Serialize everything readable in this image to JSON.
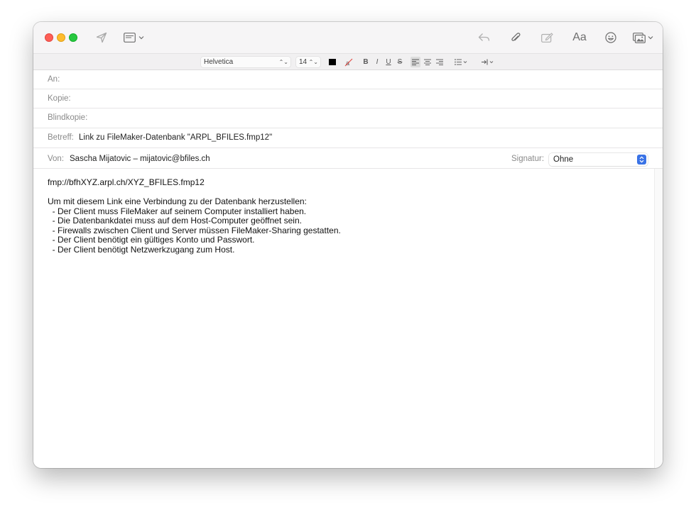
{
  "toolbar": {
    "icons": [
      "send-icon",
      "header-fields-icon",
      "chevron-down-icon",
      "reply-icon",
      "paperclip-icon",
      "markup-icon",
      "format-icon",
      "emoji-icon",
      "photo-browser-icon"
    ],
    "format_label": "Aa"
  },
  "format_bar": {
    "font": "Helvetica",
    "size": "14",
    "text_color": "#000000",
    "bold": "B",
    "italic": "I",
    "underline": "U",
    "strike": "S"
  },
  "header": {
    "to_label": "An:",
    "to_value": "",
    "cc_label": "Kopie:",
    "cc_value": "",
    "bcc_label": "Blindkopie:",
    "bcc_value": "",
    "subject_label": "Betreff:",
    "subject_value": "Link zu FileMaker-Datenbank \"ARPL_BFILES.fmp12\"",
    "from_label": "Von:",
    "from_value": "Sascha Mijatovic – mijatovic@bfiles.ch",
    "signature_label": "Signatur:",
    "signature_value": "Ohne"
  },
  "message": {
    "link": "fmp://bfhXYZ.arpl.ch/XYZ_BFILES.fmp12",
    "intro": "Um mit diesem Link eine Verbindung zu der Datenbank herzustellen:",
    "requirements": [
      "  - Der Client muss FileMaker auf seinem Computer installiert haben.",
      "  - Die Datenbankdatei muss auf dem Host-Computer geöffnet sein.",
      "  - Firewalls zwischen Client und Server müssen FileMaker-Sharing gestatten.",
      "  - Der Client benötigt ein gültiges Konto und Passwort.",
      "  - Der Client benötigt Netzwerkzugang zum Host."
    ]
  },
  "colors": {
    "close": "#fe5f57",
    "minimize": "#febc2e",
    "maximize": "#28c840",
    "accent": "#3a73e6"
  }
}
